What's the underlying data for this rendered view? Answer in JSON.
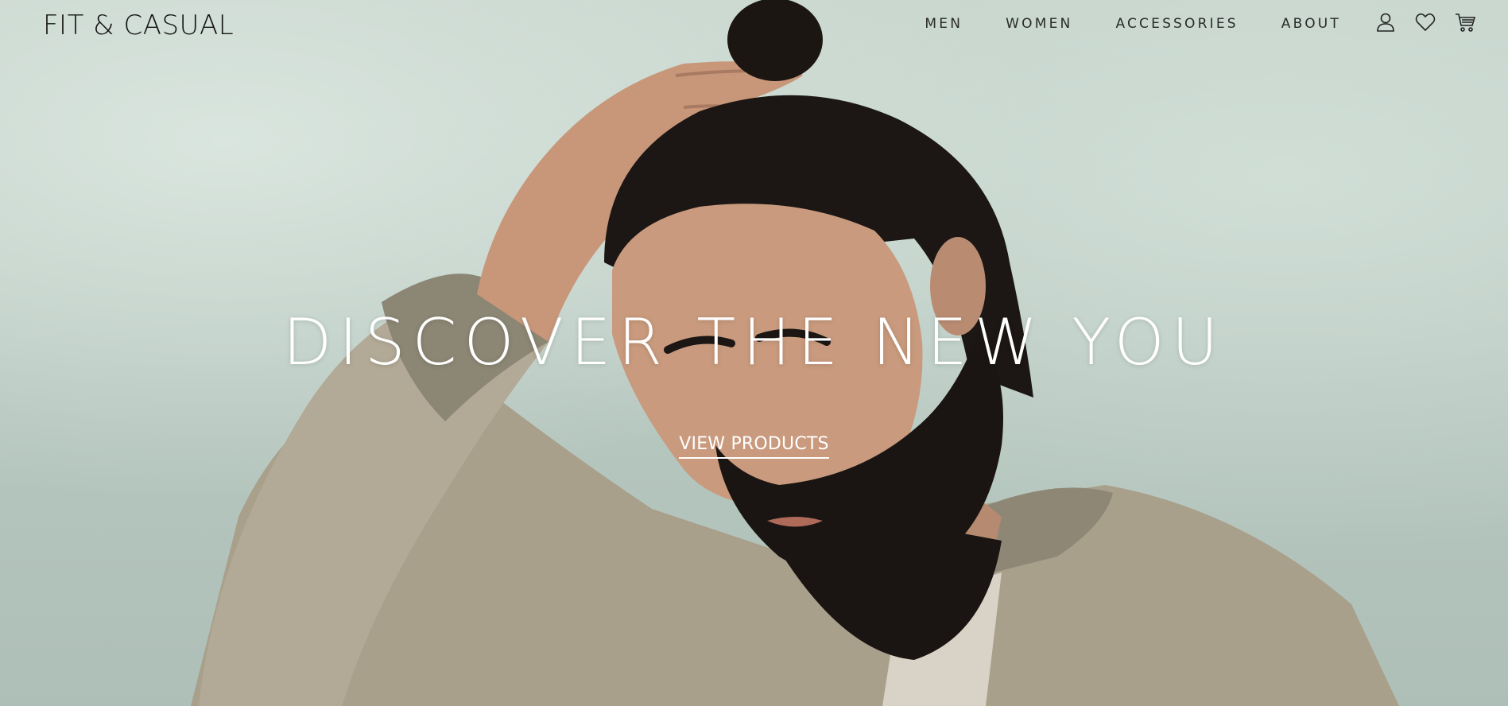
{
  "brand": {
    "logo_text": "FIT & CASUAL"
  },
  "nav": {
    "items": [
      {
        "label": "MEN"
      },
      {
        "label": "WOMEN"
      },
      {
        "label": "ACCESSORIES"
      },
      {
        "label": "ABOUT"
      }
    ]
  },
  "header_icons": [
    "user-icon",
    "heart-icon",
    "cart-icon"
  ],
  "hero": {
    "headline": "DISCOVER THE NEW YOU",
    "cta_label": "VIEW PRODUCTS",
    "image_subject": "bearded man with hair bun in beige bomber jacket, hand on head"
  },
  "colors": {
    "text_dark": "#151515",
    "hero_text": "#ffffff",
    "background": "#bfcfc7",
    "jacket": "#a89f8c",
    "hair": "#1c1714",
    "skin": "#c79a80"
  }
}
